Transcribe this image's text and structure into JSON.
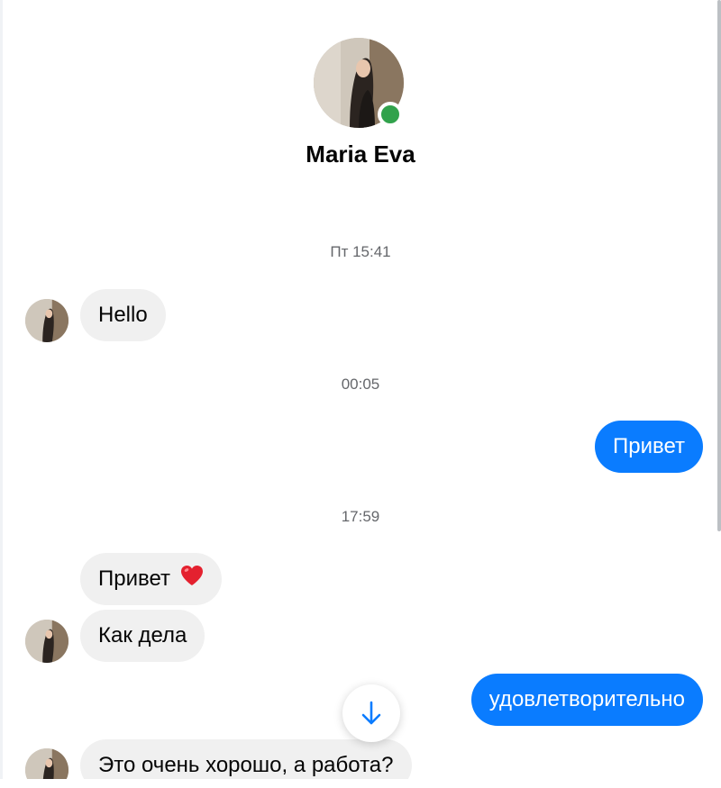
{
  "contact": {
    "name": "Maria Eva",
    "online": true
  },
  "messages": [
    {
      "type": "timestamp",
      "text": "Пт 15:41"
    },
    {
      "type": "incoming",
      "text": "Hello"
    },
    {
      "type": "timestamp",
      "text": "00:05"
    },
    {
      "type": "outgoing",
      "text": "Привет"
    },
    {
      "type": "timestamp",
      "text": "17:59"
    },
    {
      "type": "incoming",
      "text": "Привет",
      "emoji": "heart-icon"
    },
    {
      "type": "incoming",
      "text": "Как дела"
    },
    {
      "type": "outgoing",
      "text": "удовлетворительно"
    },
    {
      "type": "incoming",
      "text": "Это очень хорошо, а работа?"
    }
  ],
  "colors": {
    "outgoing_bubble": "#0a7cff",
    "incoming_bubble": "#f0f0f0",
    "online_dot": "#31a24c",
    "timestamp_text": "#65676b",
    "heart": "#e4212f"
  },
  "icons": {
    "scroll_down": "arrow-down-icon"
  }
}
